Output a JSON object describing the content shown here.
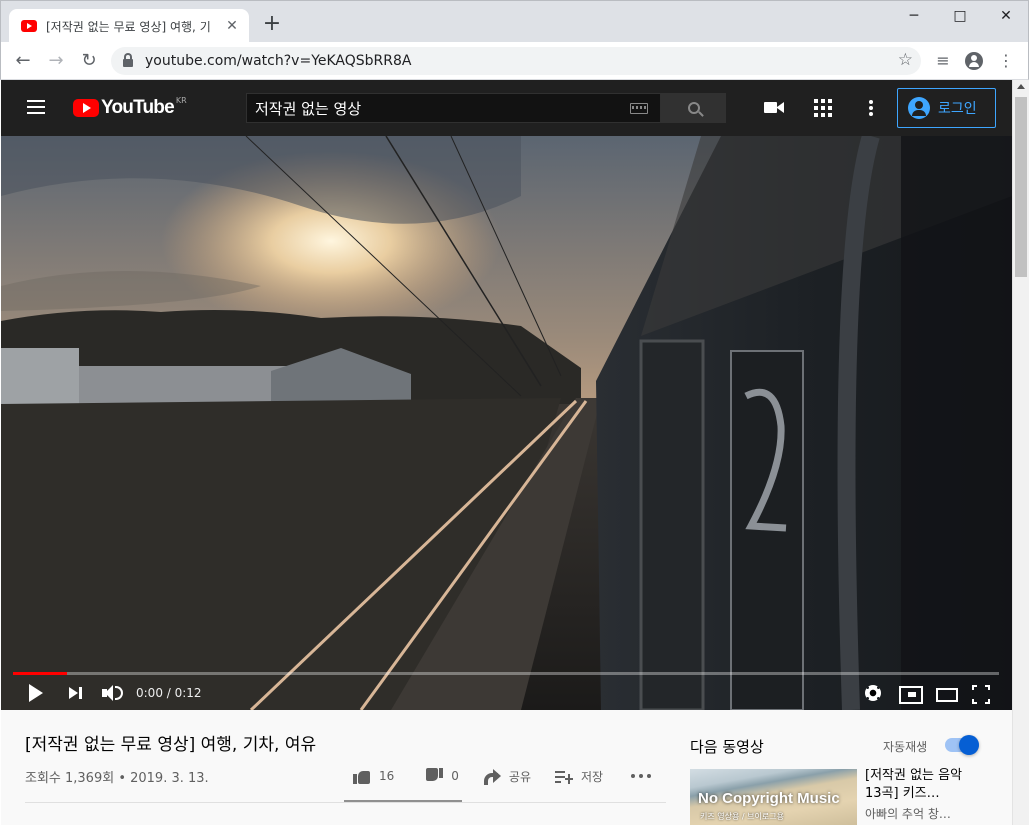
{
  "browser": {
    "tab_title": "[저작권 없는 무료 영상] 여행, 기",
    "url": "youtube.com/watch?v=YeKAQSbRR8A"
  },
  "header": {
    "logo_text": "YouTube",
    "logo_region": "KR",
    "search_value": "저작권 없는 영상",
    "login_label": "로그인"
  },
  "player": {
    "time": "0:00 / 0:12",
    "progress": 0.055
  },
  "video": {
    "title": "[저작권 없는 무료 영상] 여행, 기차, 여유",
    "meta": "조회수 1,369회 • 2019. 3. 13.",
    "likes": "16",
    "dislikes": "0",
    "share_label": "공유",
    "save_label": "저장"
  },
  "sidebar": {
    "upnext_title": "다음 동영상",
    "autoplay_label": "자동재생",
    "autoplay_on": true,
    "recommendation": {
      "thumb_title": "No Copyright Music",
      "thumb_sub": "키즈 영상용 / 브이로그용",
      "title": "[저작권 없는 음악 13곡] 키즈…",
      "channel": "아빠의 추억 창…"
    }
  },
  "colors": {
    "youtube_red": "#ff0000",
    "header_bg": "#202020",
    "login_blue": "#3ea6ff",
    "toggle_blue": "#065fd4"
  }
}
